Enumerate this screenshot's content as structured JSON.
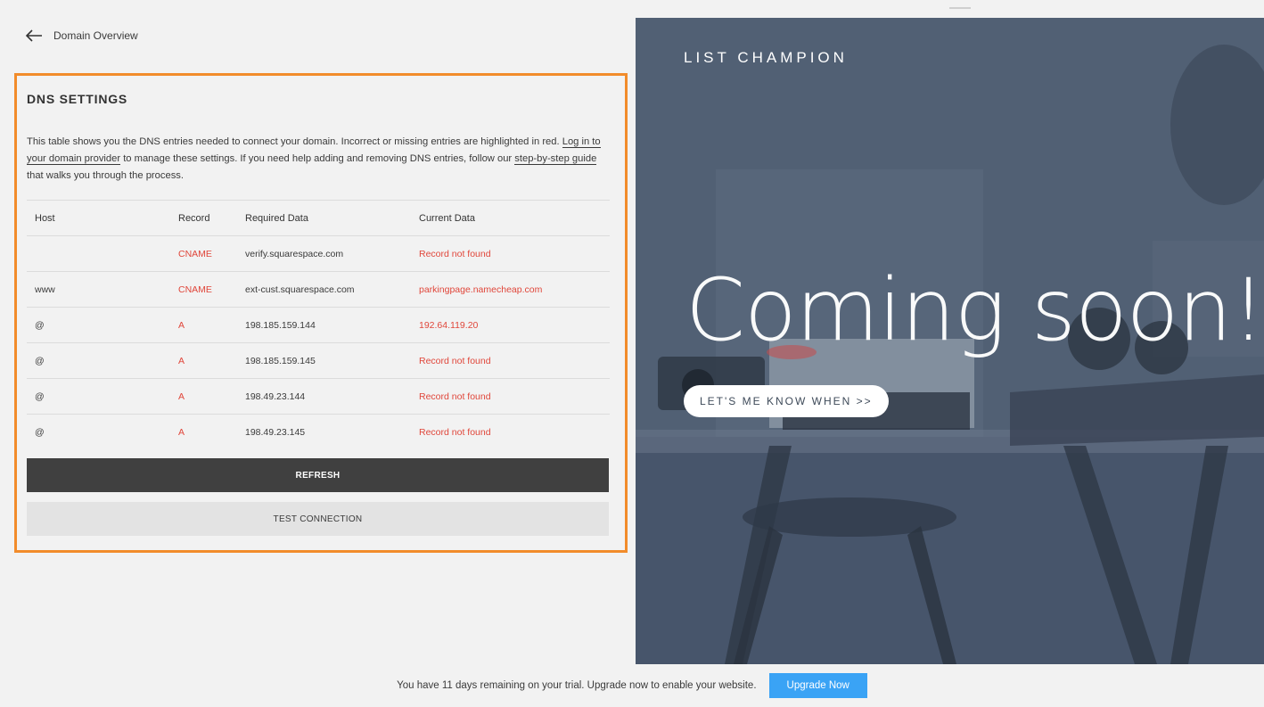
{
  "nav": {
    "back_label": "Domain Overview"
  },
  "dns": {
    "title": "DNS SETTINGS",
    "description": {
      "part1": "This table shows you the DNS entries needed to connect your domain. Incorrect or missing entries are highlighted in red. ",
      "link1": "Log in to your domain provider",
      "part2": " to manage these settings. If you need help adding and removing DNS entries, follow our ",
      "link2": "step-by-step guide",
      "part3": " that walks you through the process."
    },
    "columns": [
      "Host",
      "Record",
      "Required Data",
      "Current Data"
    ],
    "rows": [
      {
        "host": "",
        "record": "CNAME",
        "required": "verify.squarespace.com",
        "current": "Record not found"
      },
      {
        "host": "www",
        "record": "CNAME",
        "required": "ext-cust.squarespace.com",
        "current": "parkingpage.namecheap.com"
      },
      {
        "host": "@",
        "record": "A",
        "required": "198.185.159.144",
        "current": "192.64.119.20"
      },
      {
        "host": "@",
        "record": "A",
        "required": "198.185.159.145",
        "current": "Record not found"
      },
      {
        "host": "@",
        "record": "A",
        "required": "198.49.23.144",
        "current": "Record not found"
      },
      {
        "host": "@",
        "record": "A",
        "required": "198.49.23.145",
        "current": "Record not found"
      }
    ],
    "refresh_label": "REFRESH",
    "test_label": "TEST CONNECTION"
  },
  "preview": {
    "brand": "LIST CHAMPION",
    "headline": "Coming soon!",
    "cta_label": "LET'S ME KNOW WHEN >>"
  },
  "trial": {
    "message": "You have 11 days remaining on your trial. Upgrade now to enable your website.",
    "upgrade_label": "Upgrade Now"
  },
  "colors": {
    "highlight_border": "#f28c2b",
    "error_red": "#e0463a",
    "refresh_bg": "#404040",
    "upgrade_blue": "#3aa3f5",
    "preview_bg": "#4c5a6d"
  },
  "icons": {
    "back": "arrow-left-icon"
  }
}
